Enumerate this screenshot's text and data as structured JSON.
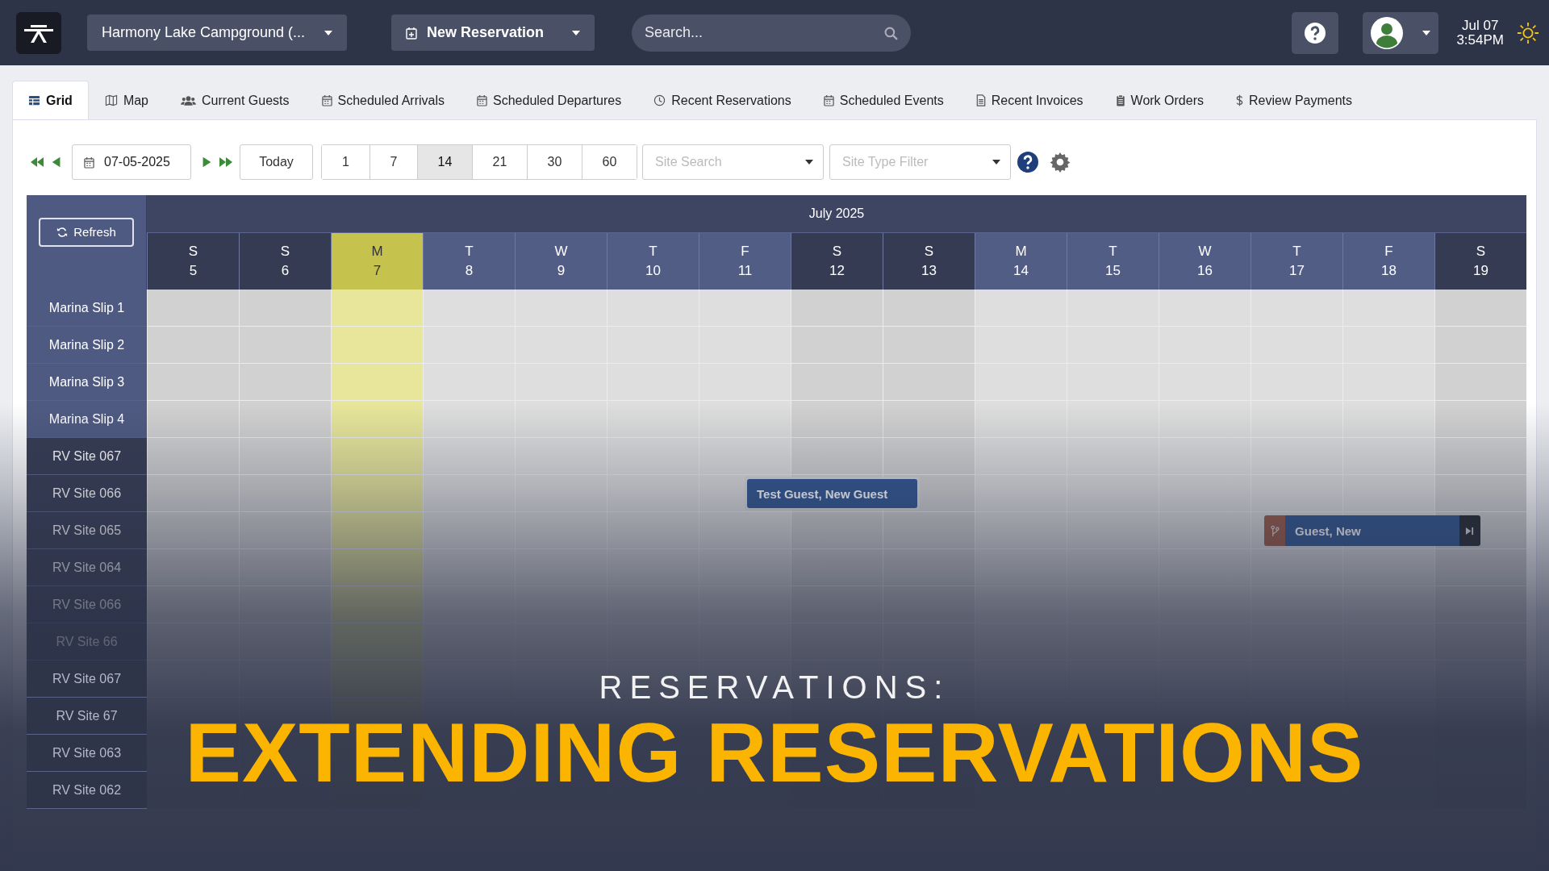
{
  "top_bar": {
    "campground": "Harmony Lake Campground (...",
    "new_reservation": "New Reservation",
    "search": {
      "placeholder": "Search..."
    },
    "date": "Jul 07",
    "time": "3:54PM"
  },
  "tabs": [
    {
      "label": "Grid",
      "kind": "grid",
      "selected": true
    },
    {
      "label": "Map",
      "kind": "map",
      "selected": false
    },
    {
      "label": "Current Guests",
      "kind": "users",
      "selected": false
    },
    {
      "label": "Scheduled Arrivals",
      "kind": "calendar",
      "selected": false
    },
    {
      "label": "Scheduled Departures",
      "kind": "calendar",
      "selected": false
    },
    {
      "label": "Recent Reservations",
      "kind": "clock",
      "selected": false
    },
    {
      "label": "Scheduled Events",
      "kind": "calendar",
      "selected": false
    },
    {
      "label": "Recent Invoices",
      "kind": "document",
      "selected": false
    },
    {
      "label": "Work Orders",
      "kind": "clipboard",
      "selected": false
    },
    {
      "label": "Review Payments",
      "kind": "dollar",
      "selected": false
    }
  ],
  "toolbar": {
    "date": "07-05-2025",
    "today": "Today",
    "ranges": [
      {
        "label": "1",
        "selected": false
      },
      {
        "label": "7",
        "selected": false
      },
      {
        "label": "14",
        "selected": true
      },
      {
        "label": "21",
        "selected": false
      },
      {
        "label": "30",
        "selected": false
      },
      {
        "label": "60",
        "selected": false
      }
    ],
    "site_search": {
      "placeholder": "Site Search"
    },
    "site_type_filter": {
      "placeholder": "Site Type Filter"
    }
  },
  "grid": {
    "refresh": "Refresh",
    "month": "July 2025",
    "days": [
      {
        "dow": "S",
        "day": "5",
        "kind": "weekend",
        "selected": false
      },
      {
        "dow": "S",
        "day": "6",
        "kind": "weekend",
        "selected": false
      },
      {
        "dow": "M",
        "day": "7",
        "kind": "weekday",
        "selected": true
      },
      {
        "dow": "T",
        "day": "8",
        "kind": "weekday",
        "selected": false
      },
      {
        "dow": "W",
        "day": "9",
        "kind": "weekday",
        "selected": false
      },
      {
        "dow": "T",
        "day": "10",
        "kind": "weekday",
        "selected": false
      },
      {
        "dow": "F",
        "day": "11",
        "kind": "weekday",
        "selected": false
      },
      {
        "dow": "S",
        "day": "12",
        "kind": "weekend",
        "selected": false
      },
      {
        "dow": "S",
        "day": "13",
        "kind": "weekend",
        "selected": false
      },
      {
        "dow": "M",
        "day": "14",
        "kind": "weekday",
        "selected": false
      },
      {
        "dow": "T",
        "day": "15",
        "kind": "weekday",
        "selected": false
      },
      {
        "dow": "W",
        "day": "16",
        "kind": "weekday",
        "selected": false
      },
      {
        "dow": "T",
        "day": "17",
        "kind": "weekday",
        "selected": false
      },
      {
        "dow": "F",
        "day": "18",
        "kind": "weekday",
        "selected": false
      },
      {
        "dow": "S",
        "day": "19",
        "kind": "weekend",
        "selected": false
      }
    ],
    "sites": [
      {
        "name": "Marina Slip 1",
        "kind": "marina"
      },
      {
        "name": "Marina Slip 2",
        "kind": "marina"
      },
      {
        "name": "Marina Slip 3",
        "kind": "marina"
      },
      {
        "name": "Marina Slip 4",
        "kind": "marina"
      },
      {
        "name": "RV Site 067",
        "kind": "rv"
      },
      {
        "name": "RV Site 066",
        "kind": "rv",
        "reservation": {
          "guest": "Test Guest, New Guest",
          "kind": "plain"
        }
      },
      {
        "name": "RV Site 065",
        "kind": "rv",
        "reservation": {
          "guest": "Guest, New",
          "kind": "split"
        }
      },
      {
        "name": "RV Site 064",
        "kind": "rv"
      },
      {
        "name": "RV Site 066",
        "kind": "rv"
      },
      {
        "name": "RV Site 66",
        "kind": "rv"
      },
      {
        "name": "RV Site 067",
        "kind": "rv"
      },
      {
        "name": "RV Site 67",
        "kind": "rv"
      },
      {
        "name": "RV Site 063",
        "kind": "rv"
      },
      {
        "name": "RV Site 062",
        "kind": "rv"
      }
    ]
  },
  "title_card": {
    "subtitle": "RESERVATIONS:",
    "title": "EXTENDING RESERVATIONS"
  }
}
